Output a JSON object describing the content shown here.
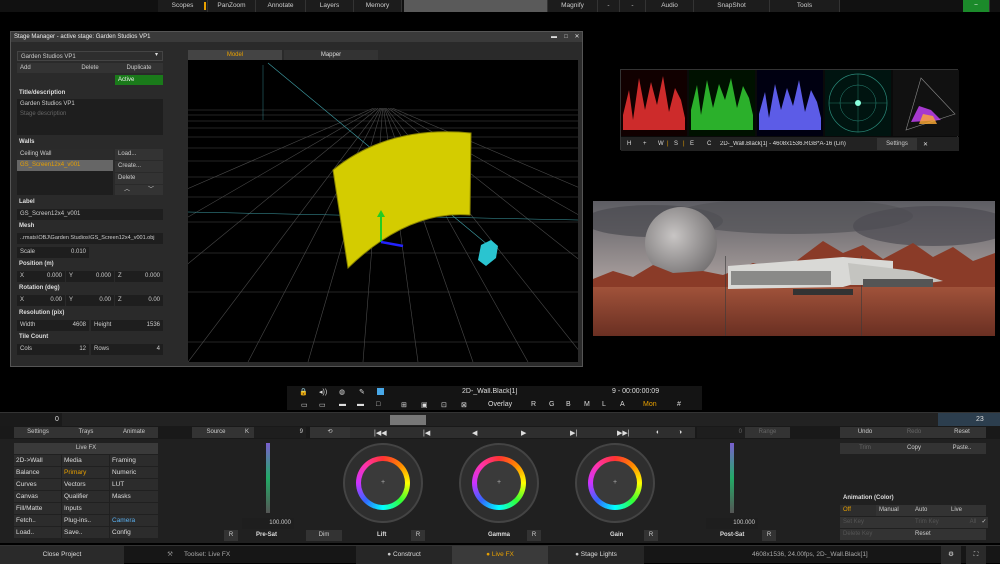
{
  "topbar": {
    "scopes": "Scopes",
    "panzoom": "PanZoom",
    "annotate": "Annotate",
    "layers": "Layers",
    "memory": "Memory",
    "magnify": "Magnify",
    "audio": "Audio",
    "snapshot": "SnapShot",
    "tools": "Tools"
  },
  "stage": {
    "title": "Stage Manager - active stage: Garden Studios VP1",
    "select": "Garden Studios VP1",
    "add": "Add",
    "delete": "Delete",
    "duplicate": "Duplicate",
    "active": "Active",
    "title_label": "Title/description",
    "title_value": "Garden Studios VP1",
    "desc_placeholder": "Stage description",
    "walls_label": "Walls",
    "walls": [
      "Ceiling Wall",
      "GS_Screen12x4_v001"
    ],
    "load": "Load...",
    "create": "Create...",
    "del": "Delete",
    "label_label": "Label",
    "label_value": "GS_Screen12x4_v001",
    "mesh_label": "Mesh",
    "mesh_value": "..rmats\\OBJ\\Garden Studios\\GS_Screen12x4_v001.obj",
    "scale_label": "Scale",
    "scale_value": "0.010",
    "pos_label": "Position (m)",
    "rot_label": "Rotation (deg)",
    "x": "X",
    "y": "Y",
    "z": "Z",
    "zero": "0.000",
    "zero2": "0.00",
    "res_label": "Resolution (pix)",
    "width_label": "Width",
    "width_value": "4608",
    "height_label": "Height",
    "height_value": "1536",
    "tile_label": "Tile Count",
    "cols_label": "Cols",
    "cols_value": "12",
    "rows_label": "Rows",
    "rows_value": "4",
    "tab_model": "Model",
    "tab_mapper": "Mapper"
  },
  "scopes": {
    "h": "H",
    "plus": "+",
    "w": "W",
    "s": "S",
    "e": "E",
    "c": "C",
    "info": "2D-_Wall.Black[1] - 4608x1536.RGB*A-16 (Lin)",
    "settings": "Settings",
    "close": "✕"
  },
  "viewer_bar": {
    "clip": "2D-_Wall.Black[1]",
    "time": "9 - 00:00:00:09",
    "overlay": "Overlay",
    "r": "R",
    "g": "G",
    "b": "B",
    "m": "M",
    "l": "L",
    "a": "A",
    "mon": "Mon",
    "hash": "#"
  },
  "timeline": {
    "start": "0",
    "end": "23"
  },
  "grade": {
    "settings": "Settings",
    "trays": "Trays",
    "animate": "Animate",
    "source": "Source",
    "k": "K",
    "frame": "9",
    "range": "Range",
    "undo": "Undo",
    "redo": "Redo",
    "reset": "Reset",
    "trim": "Trim",
    "copy": "Copy",
    "paste": "Paste..",
    "zero": "0",
    "menu_header": "Live FX",
    "menu": [
      [
        "2D->Wall",
        "Media",
        "Framing"
      ],
      [
        "Balance",
        "Primary",
        "Numeric"
      ],
      [
        "Curves",
        "Vectors",
        "LUT"
      ],
      [
        "Canvas",
        "Qualifier",
        "Masks"
      ],
      [
        "Fill/Matte",
        "Inputs",
        ""
      ],
      [
        "Fetch..",
        "Plug-ins..",
        "Camera"
      ],
      [
        "Load..",
        "Save..",
        "Config"
      ]
    ],
    "presat": "Pre-Sat",
    "presat_value": "100.000",
    "dim": "Dim",
    "lift": "Lift",
    "gamma": "Gamma",
    "gain": "Gain",
    "postsat": "Post-Sat",
    "postsat_value": "100.000",
    "r": "R",
    "anim_title": "Animation (Color)",
    "off": "Off",
    "manual": "Manual",
    "auto": "Auto",
    "live": "Live",
    "setkey": "Set Key",
    "trimkey": "Trim Key",
    "all": "All",
    "delkey": "Delete Key",
    "reset2": "Reset"
  },
  "bottom": {
    "close": "Close Project",
    "toolset": "Toolset: Live FX",
    "construct": "Construct",
    "livefx": "Live FX",
    "stagelights": "Stage Lights",
    "status": "4608x1536, 24.00fps, 2D-_Wall.Black[1]"
  }
}
